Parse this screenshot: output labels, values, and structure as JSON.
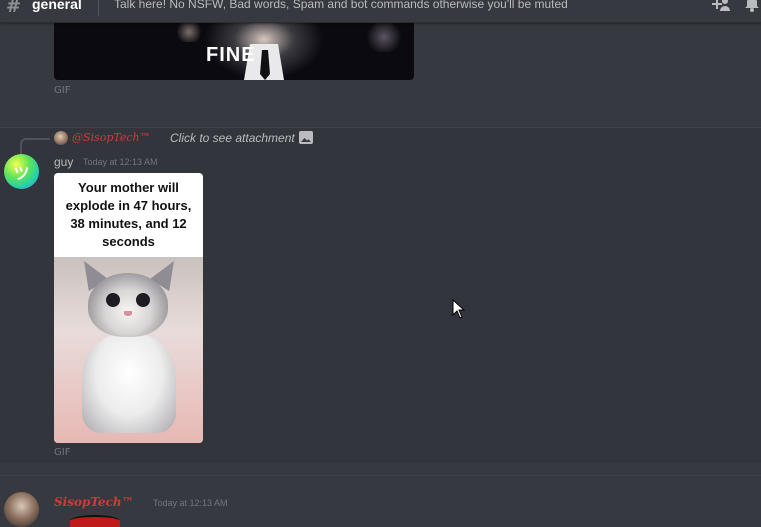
{
  "header": {
    "channel_name": "general",
    "topic": "Talk here! No NSFW, Bad words, Spam and bot commands otherwise you'll be muted"
  },
  "messages": [
    {
      "gif_caption": "FINE",
      "attachment_label": "GIF"
    },
    {
      "reply": {
        "username": "@SisopTech™",
        "text": "Click to see attachment"
      },
      "avatar_initial": "ツ",
      "username": "guy",
      "timestamp": "Today at 12:13 AM",
      "meme_text": "Your mother will explode in 47 hours, 38 minutes, and 12 seconds",
      "attachment_label": "GIF"
    },
    {
      "username": "SisopTech™",
      "timestamp": "Today at 12:13 AM"
    }
  ],
  "colors": {
    "background": "#36393f",
    "highlight": "#32353b",
    "red_username": "#d03a3a",
    "muted_text": "#72767d"
  },
  "icons": [
    "hash-icon",
    "add-member-icon",
    "bell-icon",
    "image-icon",
    "mouse-cursor-icon"
  ]
}
